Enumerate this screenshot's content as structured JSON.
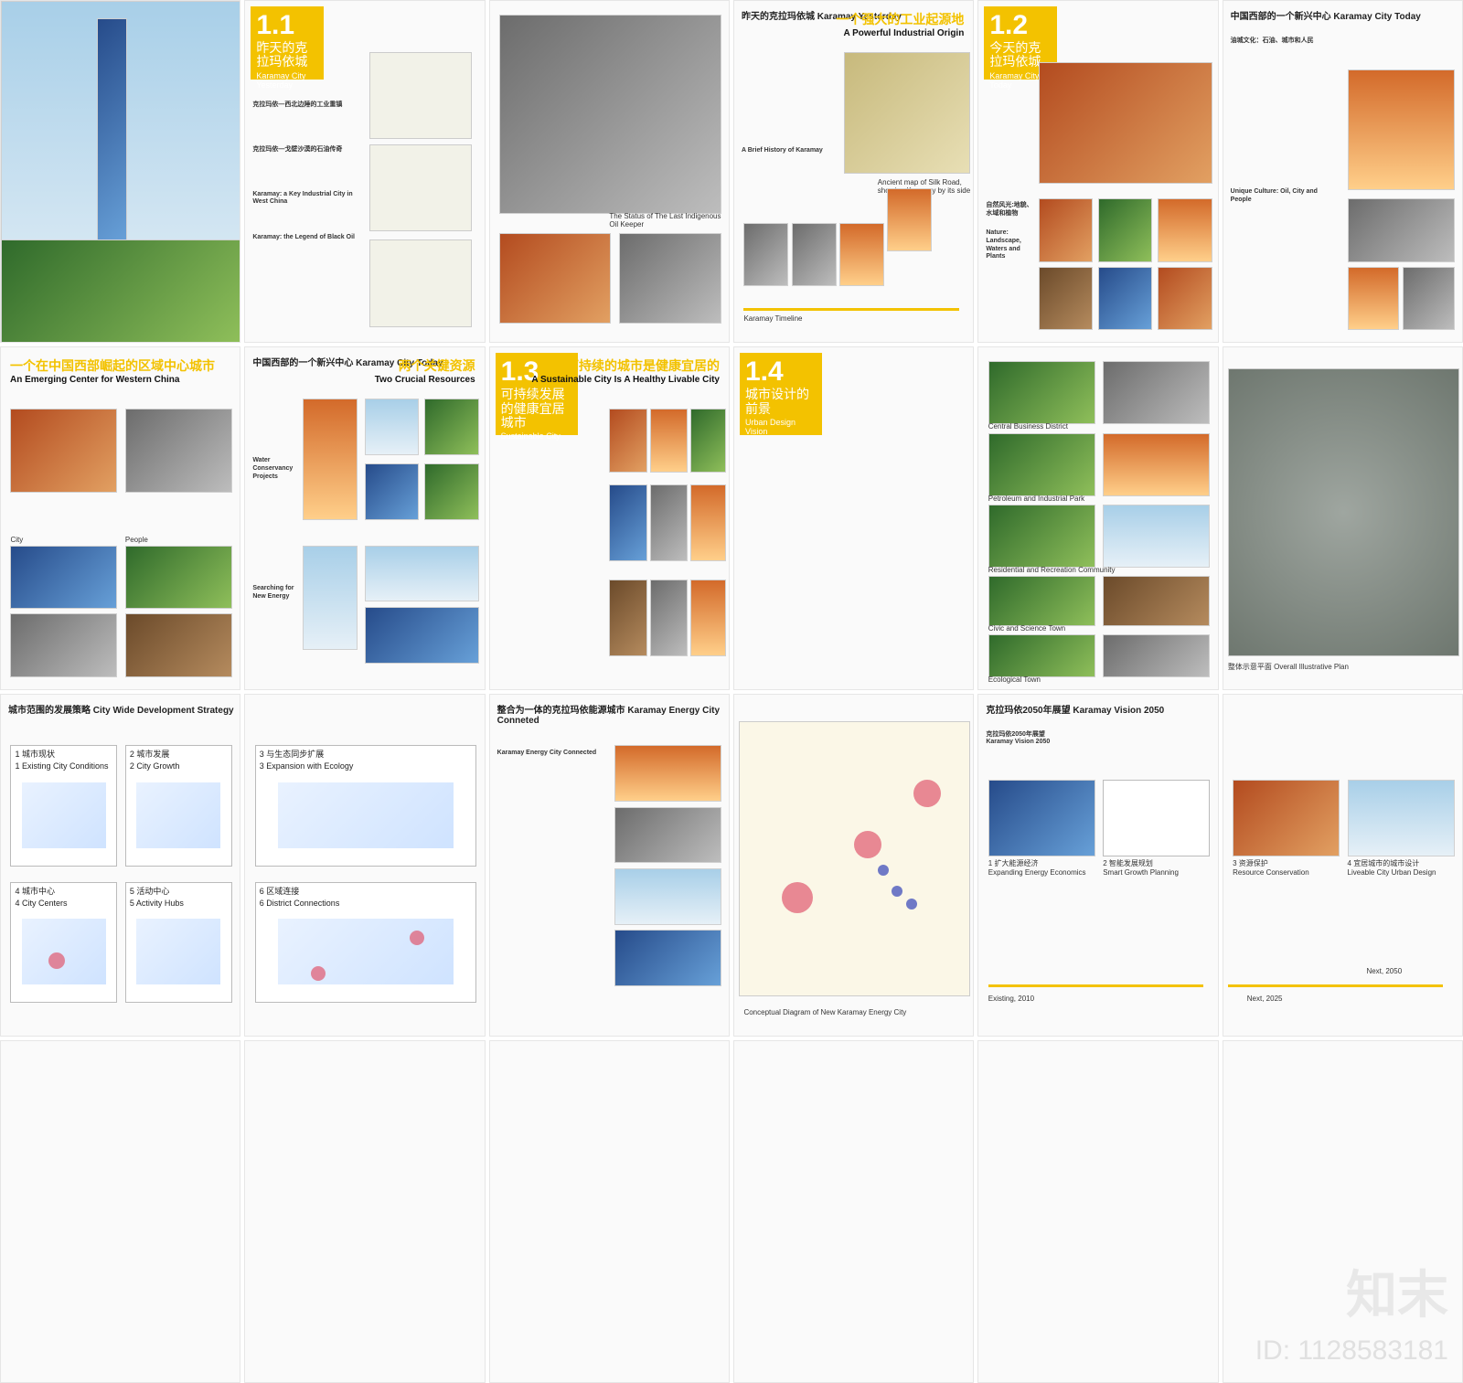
{
  "p1": {
    "number": "1.1",
    "cn_title": "昨天的克拉玛依城",
    "en_title": "Karamay City Yesterday",
    "heading1": "克拉玛依—西北边陲的工业重镇",
    "heading2": "克拉玛依—戈壁沙漠的石油传奇",
    "en_head1": "Karamay: a Key Industrial City in West China",
    "en_head2": "Karamay: the Legend of Black Oil"
  },
  "p2": {
    "caption": "The Status of The Last Indigenous Oil Keeper"
  },
  "p3": {
    "top_label": "昨天的克拉玛依城 Karamay Yesterday",
    "cn_title": "一个强大的工业起源地",
    "en_title": "A Powerful Industrial Origin",
    "brief": "A Brief History of Karamay",
    "timeline": "Karamay Timeline",
    "map_caption": "Ancient map of Silk Road, showing Karamay by its side"
  },
  "p4": {
    "number": "1.2",
    "cn_title": "今天的克拉玛依城",
    "en_title": "Karamay City Today",
    "sub1": "Nature: Landscape, Waters and Plants",
    "label_a": "自然风光:地貌、水域和植物"
  },
  "p5": {
    "top_label": "中国西部的一个新兴中心 Karamay City Today",
    "unique": "Unique Culture: Oil, City and People",
    "culture_cn": "油城文化：石油、城市和人民"
  },
  "p6": {
    "cn_title": "一个在中国西部崛起的区域中心城市",
    "en_title": "An Emerging Center for Western China",
    "city": "City",
    "people": "People"
  },
  "p7": {
    "top_label": "中国西部的一个新兴中心 Karamay City Today",
    "cn_title": "两个关键资源",
    "en_title": "Two Crucial Resources",
    "water": "Water Conservancy Projects",
    "energy": "Searching for New Energy"
  },
  "p8": {
    "number": "1.3",
    "cn_title": "可持续发展的健康宜居城市",
    "en_title": "Sustainable City",
    "yel_cn": "一座可持续的城市是健康宜居的",
    "yel_en": "A Sustainable City Is A Healthy Livable City"
  },
  "p9": {
    "number": "1.4",
    "cn_title": "城市设计的前景",
    "en_title": "Urban Design Vision"
  },
  "p10": {
    "labels": [
      "Central Business District",
      "Petroleum and Industrial Park",
      "Residential and Recreation Community",
      "Civic and Science Town",
      "Ecological Town"
    ]
  },
  "p11": {
    "caption": "整体示意平面 Overall Illustrative Plan"
  },
  "p12": {
    "top_label": "城市范围的发展策略 City Wide Development Strategy",
    "boxes": [
      {
        "cn": "1 城市现状",
        "en": "1 Existing City Conditions"
      },
      {
        "cn": "2 城市发展",
        "en": "2 City Growth"
      },
      {
        "cn": "3 与生态同步扩展",
        "en": "3 Expansion with Ecology"
      },
      {
        "cn": "4 城市中心",
        "en": "4 City Centers"
      },
      {
        "cn": "5 活动中心",
        "en": "5 Activity Hubs"
      },
      {
        "cn": "6 区域连接",
        "en": "6 District Connections"
      }
    ]
  },
  "p13": {
    "top_label": "整合为一体的克拉玛依能源城市 Karamay Energy City Conneted",
    "heading": "Karamay Energy City Connected",
    "caption": "Conceptual Diagram of New Karamay Energy City"
  },
  "p14": {
    "top_label": "克拉玛依2050年展望 Karamay Vision 2050",
    "heading_cn": "克拉玛依2050年展望",
    "heading_en": "Karamay Vision 2050",
    "items": [
      {
        "cn": "1 扩大能源经济",
        "en": "Expanding Energy Economics"
      },
      {
        "cn": "2 智能发展规划",
        "en": "Smart Growth Planning"
      },
      {
        "cn": "3 资源保护",
        "en": "Resource Conservation"
      },
      {
        "cn": "4 宜居城市的城市设计",
        "en": "Liveable City Urban Design"
      }
    ],
    "timeline": [
      "Existing, 2010",
      "Next, 2025",
      "Next, 2050"
    ]
  },
  "watermark": {
    "logo": "知末",
    "id": "ID: 1128583181"
  }
}
